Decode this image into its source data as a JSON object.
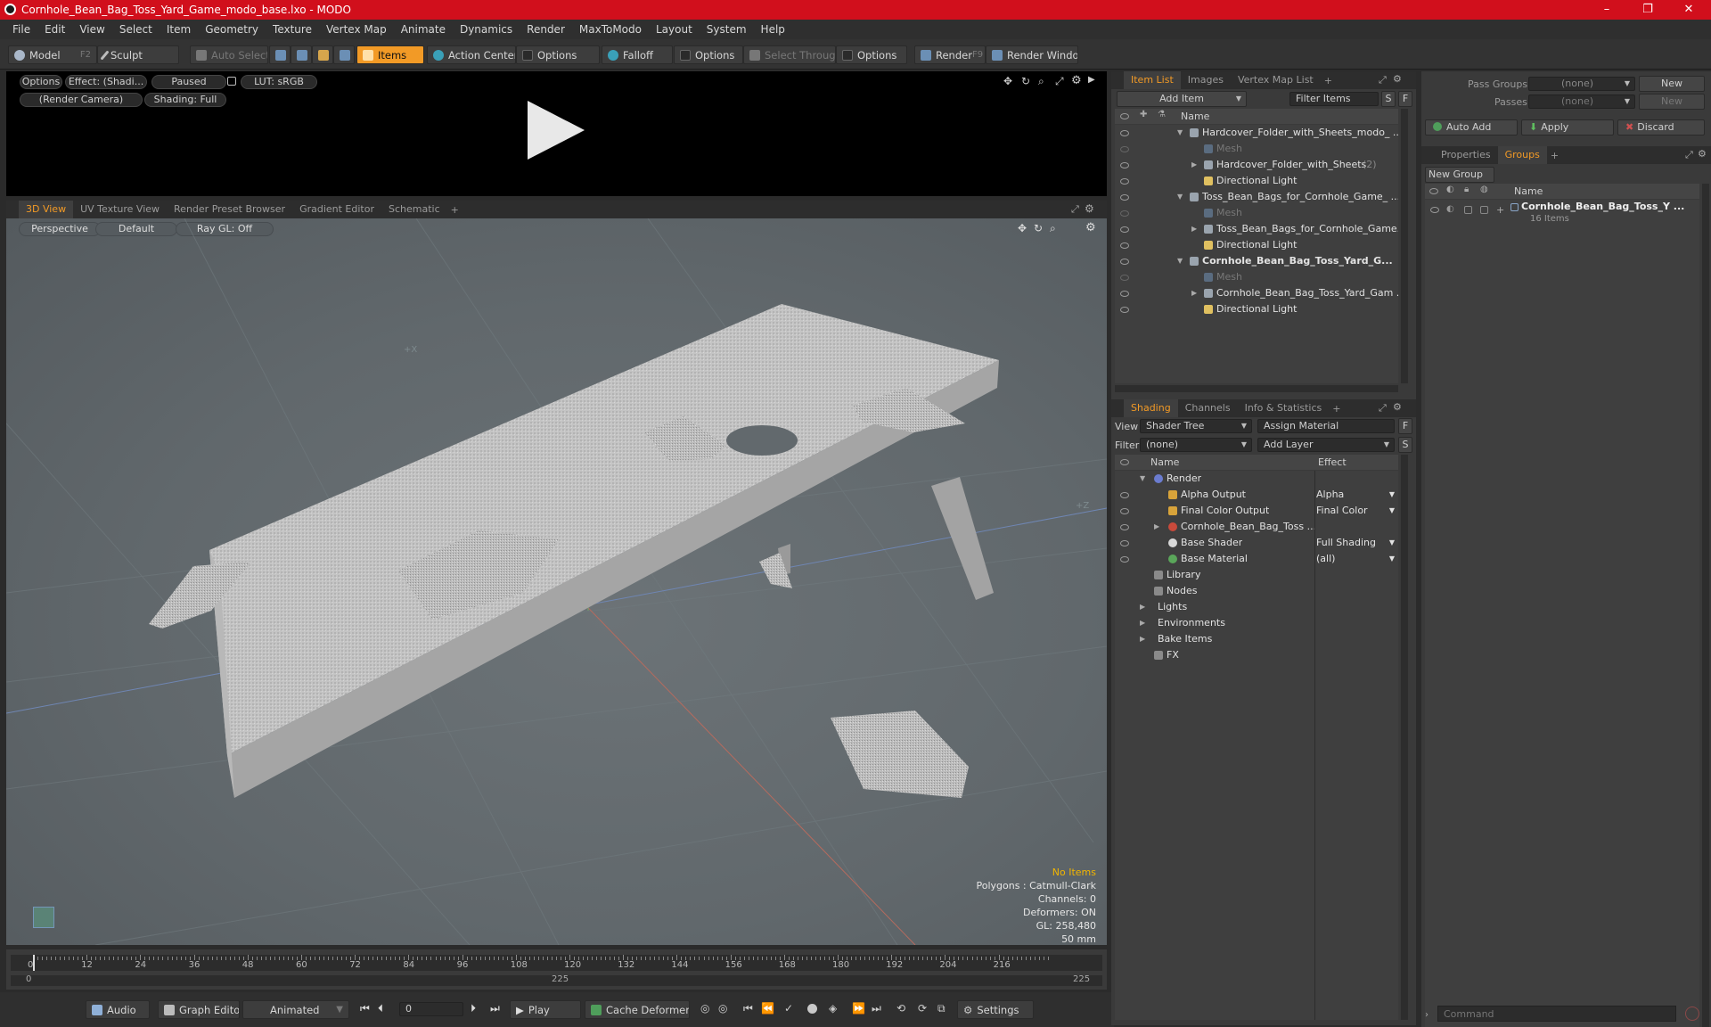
{
  "window": {
    "title": "Cornhole_Bean_Bag_Toss_Yard_Game_modo_base.lxo - MODO",
    "controls": [
      "–",
      "❐",
      "✕"
    ]
  },
  "menu": [
    "File",
    "Edit",
    "View",
    "Select",
    "Item",
    "Geometry",
    "Texture",
    "Vertex Map",
    "Animate",
    "Dynamics",
    "Render",
    "MaxToModo",
    "Layout",
    "System",
    "Help"
  ],
  "toolbar": {
    "model": "Model",
    "model_key": "F2",
    "sculpt": "Sculpt",
    "auto_select": "Auto Select",
    "items": "Items",
    "action_center": "Action Center",
    "options1": "Options",
    "falloff": "Falloff",
    "options2": "Options",
    "select_through": "Select Through",
    "options3": "Options",
    "render": "Render",
    "render_key": "F9",
    "render_window": "Render Window"
  },
  "preview": {
    "options": "Options",
    "effect": "Effect: (Shadi...",
    "paused": "Paused",
    "lut": "LUT: sRGB",
    "camera": "(Render Camera)",
    "shading": "Shading: Full"
  },
  "viewport_tabs": [
    "3D View",
    "UV Texture View",
    "Render Preset Browser",
    "Gradient Editor",
    "Schematic"
  ],
  "viewport": {
    "perspective": "Perspective",
    "default": "Default",
    "raygl": "Ray GL: Off",
    "axis_x": "+X",
    "axis_z": "+Z",
    "stats": {
      "no_items": "No Items",
      "polygons": "Polygons : Catmull-Clark",
      "channels": "Channels: 0",
      "deformers": "Deformers: ON",
      "gl": "GL: 258,480",
      "scale": "50 mm"
    }
  },
  "timeline": {
    "ticks": [
      "0",
      "12",
      "24",
      "36",
      "48",
      "60",
      "72",
      "84",
      "96",
      "108",
      "120",
      "132",
      "144",
      "156",
      "168",
      "180",
      "192",
      "204",
      "216"
    ],
    "range_start": "0",
    "range_mid": "225",
    "range_end": "225"
  },
  "transport": {
    "audio": "Audio",
    "graph_editor": "Graph Editor",
    "animated": "Animated",
    "frame": "0",
    "play": "Play",
    "cache_deformers": "Cache Deformers",
    "settings": "Settings"
  },
  "itemlist": {
    "tabs": [
      "Item List",
      "Images",
      "Vertex Map List"
    ],
    "add_item": "Add Item",
    "filter_items": "Filter Items",
    "col_name": "Name",
    "btn_s": "S",
    "btn_f": "F",
    "rows": [
      {
        "label": "Hardcover_Folder_with_Sheets_modo_ ...",
        "indent": 0,
        "type": "scene"
      },
      {
        "label": "Mesh",
        "indent": 1,
        "type": "mesh-dim"
      },
      {
        "label": "Hardcover_Folder_with_Sheets",
        "count": "(2)",
        "indent": 1,
        "type": "group"
      },
      {
        "label": "Directional Light",
        "indent": 1,
        "type": "light"
      },
      {
        "label": "Toss_Bean_Bags_for_Cornhole_Game_ ...",
        "indent": 0,
        "type": "scene"
      },
      {
        "label": "Mesh",
        "indent": 1,
        "type": "mesh-dim"
      },
      {
        "label": "Toss_Bean_Bags_for_Cornhole_Game...",
        "indent": 1,
        "type": "group"
      },
      {
        "label": "Directional Light",
        "indent": 1,
        "type": "light"
      },
      {
        "label": "Cornhole_Bean_Bag_Toss_Yard_G...",
        "indent": 0,
        "type": "scene-bold"
      },
      {
        "label": "Mesh",
        "indent": 1,
        "type": "mesh-dim"
      },
      {
        "label": "Cornhole_Bean_Bag_Toss_Yard_Gam ...",
        "indent": 1,
        "type": "group"
      },
      {
        "label": "Directional Light",
        "indent": 1,
        "type": "light"
      }
    ]
  },
  "shading": {
    "tabs": [
      "Shading",
      "Channels",
      "Info & Statistics"
    ],
    "view_label": "View",
    "view_value": "Shader Tree",
    "assign_material": "Assign Material",
    "filter_label": "Filter",
    "filter_value": "(none)",
    "add_layer": "Add Layer",
    "btn_f": "F",
    "btn_s": "S",
    "col_name": "Name",
    "col_effect": "Effect",
    "rows": [
      {
        "label": "Render",
        "effect": "",
        "indent": 0
      },
      {
        "label": "Alpha Output",
        "effect": "Alpha",
        "indent": 1
      },
      {
        "label": "Final Color Output",
        "effect": "Final Color",
        "indent": 1
      },
      {
        "label": "Cornhole_Bean_Bag_Toss ...",
        "effect": "",
        "indent": 1
      },
      {
        "label": "Base Shader",
        "effect": "Full Shading",
        "indent": 1
      },
      {
        "label": "Base Material",
        "effect": "(all)",
        "indent": 1
      },
      {
        "label": "Library",
        "effect": "",
        "indent": 0
      },
      {
        "label": "Nodes",
        "effect": "",
        "indent": 0
      },
      {
        "label": "Lights",
        "effect": "",
        "indent": -1
      },
      {
        "label": "Environments",
        "effect": "",
        "indent": -1
      },
      {
        "label": "Bake Items",
        "effect": "",
        "indent": -1
      },
      {
        "label": "FX",
        "effect": "",
        "indent": 0
      }
    ]
  },
  "groups": {
    "pass_groups_label": "Pass Groups",
    "pass_groups_value": "(none)",
    "passes_label": "Passes",
    "passes_value": "(none)",
    "new": "New",
    "new2": "New",
    "auto_add": "Auto Add",
    "apply": "Apply",
    "discard": "Discard",
    "tabs": [
      "Properties",
      "Groups"
    ],
    "new_group": "New Group",
    "col_name": "Name",
    "group_name": "Cornhole_Bean_Bag_Toss_Y ...",
    "group_count": "16 Items",
    "command_placeholder": "Command"
  }
}
